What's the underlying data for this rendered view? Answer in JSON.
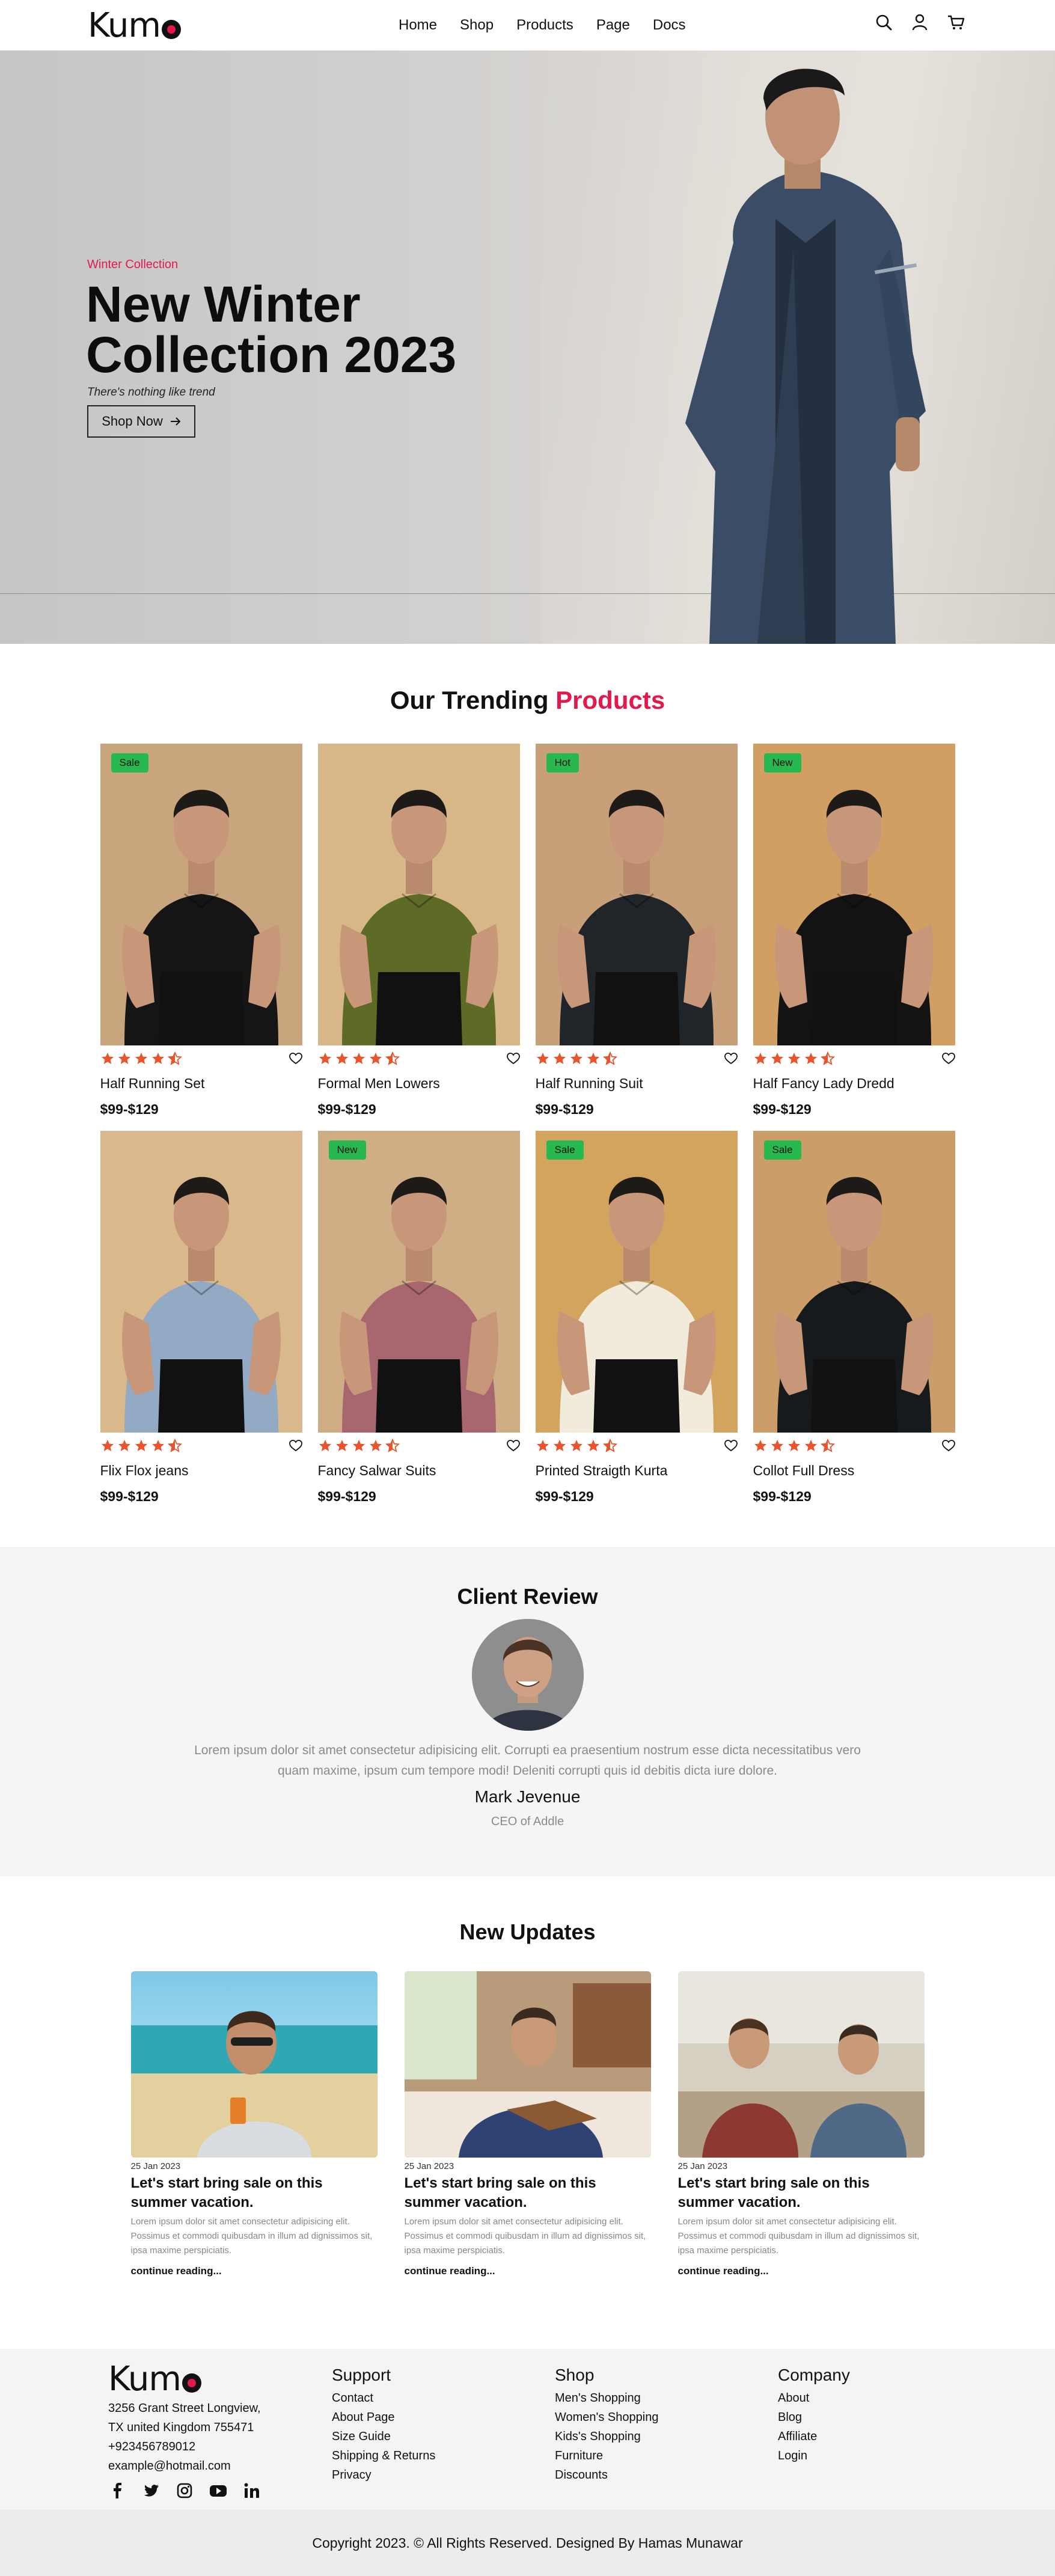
{
  "brand": {
    "name": "Kum",
    "accent_color": "#e3194c"
  },
  "nav": {
    "links": [
      "Home",
      "Shop",
      "Products",
      "Page",
      "Docs"
    ],
    "icons": [
      "search-icon",
      "user-icon",
      "cart-icon"
    ]
  },
  "hero": {
    "subtitle": "Winter Collection",
    "title": "New Winter Collection 2023",
    "tagline": "There's nothing like trend",
    "cta": "Shop Now"
  },
  "trending": {
    "title_prefix": "Our Trending",
    "title_accent": "Products",
    "rating": 4.5,
    "products": [
      {
        "name": "Half Running Set",
        "price": "$99-$129",
        "badge": "Sale",
        "shirt": "#151515",
        "bg": "#c9a57e"
      },
      {
        "name": "Formal Men Lowers",
        "price": "$99-$129",
        "badge": "",
        "shirt": "#5d6b26",
        "bg": "#d7b688"
      },
      {
        "name": "Half Running Suit",
        "price": "$99-$129",
        "badge": "Hot",
        "shirt": "#1f2528",
        "bg": "#c7a07a"
      },
      {
        "name": "Half Fancy Lady Dredd",
        "price": "$99-$129",
        "badge": "New",
        "shirt": "#131313",
        "bg": "#d19f63"
      },
      {
        "name": "Flix Flox jeans",
        "price": "$99-$129",
        "badge": "",
        "shirt": "#92aac4",
        "bg": "#d9b88c"
      },
      {
        "name": "Fancy Salwar Suits",
        "price": "$99-$129",
        "badge": "New",
        "shirt": "#a8676f",
        "bg": "#cfad85"
      },
      {
        "name": "Printed Straigth Kurta",
        "price": "$99-$129",
        "badge": "Sale",
        "shirt": "#f0ebdb",
        "bg": "#d3a45e"
      },
      {
        "name": "Collot Full Dress",
        "price": "$99-$129",
        "badge": "Sale",
        "shirt": "#171a1d",
        "bg": "#cb9d68"
      }
    ]
  },
  "review": {
    "title": "Client Review",
    "quote": "Lorem ipsum dolor sit amet consectetur adipisicing elit. Corrupti ea praesentium nostrum esse dicta necessitatibus vero quam maxime, ipsum cum tempore modi! Deleniti corrupti quis id debitis dicta iure dolore.",
    "name": "Mark Jevenue",
    "role": "CEO of Addle"
  },
  "updates": {
    "title": "New Updates",
    "posts": [
      {
        "date": "25 Jan 2023",
        "title": "Let's start bring sale on this summer vacation.",
        "excerpt": "Lorem ipsum dolor sit amet consectetur adipisicing elit. Possimus et commodi quibusdam in illum ad dignissimos sit, ipsa maxime perspiciatis.",
        "more": "continue reading..."
      },
      {
        "date": "25 Jan 2023",
        "title": "Let's start bring sale on this summer vacation.",
        "excerpt": "Lorem ipsum dolor sit amet consectetur adipisicing elit. Possimus et commodi quibusdam in illum ad dignissimos sit, ipsa maxime perspiciatis.",
        "more": "continue reading..."
      },
      {
        "date": "25 Jan 2023",
        "title": "Let's start bring sale on this summer vacation.",
        "excerpt": "Lorem ipsum dolor sit amet consectetur adipisicing elit. Possimus et commodi quibusdam in illum ad dignissimos sit, ipsa maxime perspiciatis.",
        "more": "continue reading..."
      }
    ]
  },
  "footer": {
    "address": [
      "3256 Grant Street Longview,",
      "TX united Kingdom 755471",
      "+923456789012",
      "example@hotmail.com"
    ],
    "socials": [
      "facebook-icon",
      "twitter-icon",
      "instagram-icon",
      "youtube-icon",
      "linkedin-icon"
    ],
    "support": {
      "title": "Support",
      "links": [
        "Contact",
        "About Page",
        "Size Guide",
        "Shipping & Returns",
        "Privacy"
      ]
    },
    "shop": {
      "title": "Shop",
      "links": [
        "Men's Shopping",
        "Women's Shopping",
        "Kids's Shopping",
        "Furniture",
        "Discounts"
      ]
    },
    "company": {
      "title": "Company",
      "links": [
        "About",
        "Blog",
        "Affiliate",
        "Login"
      ]
    },
    "copyright": "Copyright 2023. © All Rights Reserved. Designed By Hamas Munawar"
  }
}
